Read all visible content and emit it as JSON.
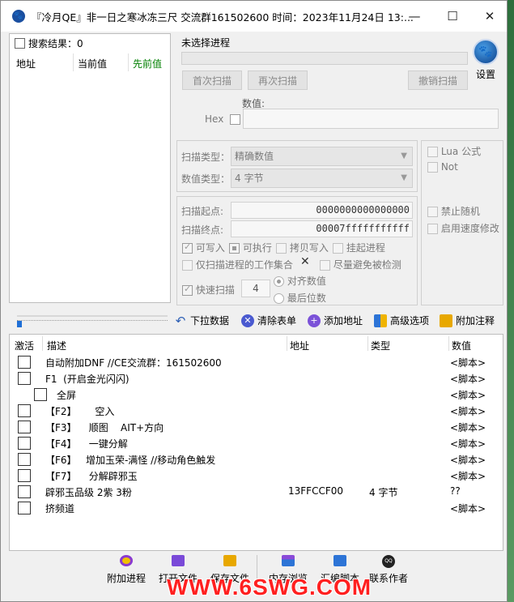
{
  "titlebar": {
    "title": "『冷月QE』非一日之寒冰冻三尺  交流群161502600  时间：2023年11月24日  13:...",
    "minimize": "—",
    "maximize": "☐",
    "close": "✕"
  },
  "results": {
    "label": "搜索结果：0",
    "col_address": "地址",
    "col_current": "当前值",
    "col_previous": "先前值",
    "previous_color": "#008000"
  },
  "process": {
    "label": "未选择进程",
    "settings_label": "设置"
  },
  "scan_buttons": {
    "first_scan": "首次扫描",
    "next_scan": "再次扫描",
    "undo_scan": "撤销扫描"
  },
  "value": {
    "label": "数值:",
    "hex_label": "Hex"
  },
  "scan_type": {
    "label": "扫描类型：",
    "value": "精确数值"
  },
  "value_type": {
    "label": "数值类型：",
    "value": "4 字节"
  },
  "side_options": {
    "lua": "Lua 公式",
    "not": "Not",
    "no_random": "禁止随机",
    "speedhack": "启用速度修改"
  },
  "memory": {
    "start_label": "扫描起点:",
    "start_value": "0000000000000000",
    "stop_label": "扫描终点:",
    "stop_value": "00007fffffffffff",
    "writable": "可写入",
    "executable": "可执行",
    "copy_on_write": "拷贝写入",
    "suspend": "挂起进程",
    "only_workset": "仅扫描进程的工作集合",
    "x_mark": "✕",
    "avoid_detect": "尽量避免被检测",
    "fast_scan": "快速扫描",
    "fast_scan_value": "4",
    "align": "对齐数值",
    "last_digits": "最后位数"
  },
  "toolbar": {
    "pull_data": "下拉数据",
    "clear_list": "清除表单",
    "add_address": "添加地址",
    "advanced": "高级选项",
    "add_comment": "附加注释",
    "progress": 0
  },
  "table": {
    "col_active": "激活",
    "col_desc": "描述",
    "col_address": "地址",
    "col_type": "类型",
    "col_value": "数值",
    "rows": [
      {
        "desc": "自动附加DNF //CE交流群：161502600",
        "address": "",
        "type": "",
        "value": "<脚本>",
        "indent": 0
      },
      {
        "desc": "F1  (开启金光闪闪)",
        "address": "",
        "type": "",
        "value": "<脚本>",
        "indent": 0
      },
      {
        "desc": "全屏",
        "address": "",
        "type": "",
        "value": "<脚本>",
        "indent": 1
      },
      {
        "desc": "【F2】      空入",
        "address": "",
        "type": "",
        "value": "<脚本>",
        "indent": 0
      },
      {
        "desc": "【F3】    顺图    AIT+方向",
        "address": "",
        "type": "",
        "value": "<脚本>",
        "indent": 0
      },
      {
        "desc": "【F4】    一键分解",
        "address": "",
        "type": "",
        "value": "<脚本>",
        "indent": 0
      },
      {
        "desc": "【F6】   增加玉荣-满怪 //移动角色触发",
        "address": "",
        "type": "",
        "value": "<脚本>",
        "indent": 0
      },
      {
        "desc": "【F7】    分解辟邪玉",
        "address": "",
        "type": "",
        "value": "<脚本>",
        "indent": 0
      },
      {
        "desc": "辟邪玉品级 2紫 3粉",
        "address": "13FFCCF00",
        "type": "4 字节",
        "value": "??",
        "indent": 0
      },
      {
        "desc": "挤频道",
        "address": "",
        "type": "",
        "value": "<脚本>",
        "indent": 0
      }
    ]
  },
  "bottom": {
    "attach_process": "附加进程",
    "open_file": "打开文件",
    "save_file": "保存文件",
    "memory_view": "内存浏览",
    "assemble_script": "汇编脚本",
    "contact_author": "联系作者",
    "qq_label": "QQ"
  },
  "watermark": "WWW.6SWG.COM"
}
